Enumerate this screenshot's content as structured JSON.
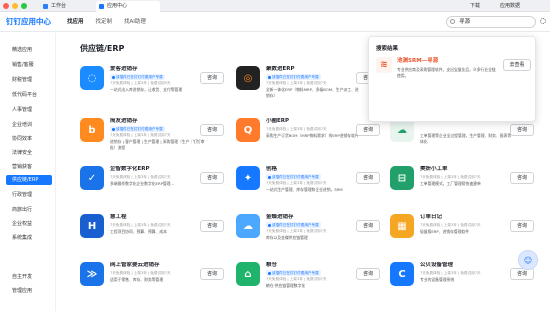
{
  "browser": {
    "tabs": [
      {
        "label": "工作台",
        "color": "#2b7ffc"
      },
      {
        "label": "应用中心",
        "color": "#1677ff"
      }
    ],
    "right_items": [
      "下载",
      "应用数据"
    ]
  },
  "header": {
    "brand": "钉钉应用中心",
    "nav": [
      "找应用",
      "找定制",
      "找AI助理"
    ],
    "search_value": "寻源"
  },
  "sidebar": {
    "items": [
      "精选应用",
      "销售/客服",
      "财税管理",
      "低代码平台",
      "人事管理",
      "企业培训",
      "协同效率",
      "法律安全",
      "营销获客",
      "供应链/ERP",
      "行政管理",
      "商旅出行",
      "企业权益",
      "系统集成",
      "自主开发",
      "管理应用"
    ],
    "active_index": 9
  },
  "main": {
    "section_title": "供应链/ERP",
    "consult_label": "咨询",
    "cards": [
      {
        "name": "爱客进销存",
        "badge": "该插件已在钉钉付费用户专属",
        "meta": "7天免费体验 | 上架3年 | 免费试用5天",
        "desc": "一站式出入库进销存，让收货、支付等管理",
        "logo_color": "#1a8cff",
        "logo_text": "◌"
      },
      {
        "name": "聚数进ERP",
        "badge": "该插件已在钉钉付费用户专属",
        "meta": "7天免费体验 | 上架3年 | 免费试用7天",
        "desc": "全新一体化ERP（物料MRP、多级BOM、生产派工、进销存）",
        "logo_color": "#222",
        "logo_text": "◎"
      },
      {
        "name": "",
        "badge": "",
        "meta": "",
        "desc": "",
        "logo_color": "#3d8bf5",
        "logo_text": "▤"
      },
      {
        "name": "简友进销存",
        "badge": "该插件已在钉钉付费用户专属",
        "meta": "7天免费体验 | 上架3年 | 免费试用7天",
        "desc": "进销存 | 客户管理 | 生产管理 | 采购管理（生产｜钉钉审批）流程",
        "logo_color": "#ff8a1f",
        "logo_text": "b"
      },
      {
        "name": "小圈ERP",
        "badge": "",
        "meta": "7天免费体验 | 上架3年 | 免费试用7天",
        "desc": "采购生产订货BOM（MRP物料需求）的ERP进销存软件",
        "logo_color": "#ff7a2a",
        "logo_text": "Q"
      },
      {
        "name": "",
        "badge": "",
        "meta": "",
        "desc": "工单管理等企业全过程管理，生产管理、财务、报表等一体化",
        "logo_color": "#e8f5ee",
        "logo_text": "☁"
      },
      {
        "name": "企智数字化ERP",
        "badge": "",
        "meta": "7天免费体验 | 上架3年 | 免费试用7天",
        "desc": "多端操作数字化企业数字化ERP管理...",
        "logo_color": "#1a73e8",
        "logo_text": "✓"
      },
      {
        "name": "创格",
        "badge": "该插件已在钉钉付费用户专属",
        "meta": "7天免费体验 | 上架3年 | 免费试用7天",
        "desc": "一站式生产管理、库存管理和企业进销，SRM",
        "logo_color": "#1677ff",
        "logo_text": "✦"
      },
      {
        "name": "美妍小工单",
        "badge": "",
        "meta": "7天免费体验 | 上架3年 | 免费试用7天",
        "desc": "工单管理模式，工厂管理帮快速建单",
        "logo_color": "#22a06b",
        "logo_text": "⊟"
      },
      {
        "name": "慧工程",
        "badge": "",
        "meta": "7天免费体验 | 上架3年 | 免费试用7天",
        "desc": "工程项目协同、预算、预算、成本",
        "logo_color": "#1a5fd0",
        "logo_text": "H"
      },
      {
        "name": "金蝶进销存",
        "badge": "该插件已在钉钉付费用户专属",
        "meta": "7天免费体验 | 上架3年 | 免费试用7天",
        "desc": "库存以及金蝶供应链管理",
        "logo_color": "#4ca7ff",
        "logo_text": "☁"
      },
      {
        "name": "订单日记",
        "badge": "",
        "meta": "7天免费体验 | 上架3年 | 免费试用7天",
        "desc": "轻量版ERP、进销存管理软件",
        "logo_color": "#f5a623",
        "logo_text": "▦"
      },
      {
        "name": "网上管家婆云进销存",
        "badge": "",
        "meta": "7天免费体验 | 上架3年 | 免费试用7天",
        "desc": "适用于零售、库存、财务等管理",
        "logo_color": "#1a73e8",
        "logo_text": "≫"
      },
      {
        "name": "粮仓",
        "badge": "该插件已在钉钉付费用户专属",
        "meta": "7天免费体验 | 上架3年 | 免费试用7天",
        "desc": "粮仓·供应链管理数字化",
        "logo_color": "#1fb36b",
        "logo_text": "⌂"
      },
      {
        "name": "公贝设备管理",
        "badge": "",
        "meta": "7天免费体验 | 上架3年 | 免费试用7天",
        "desc": "专业的设备管理系统",
        "logo_color": "#1677ff",
        "logo_text": "C"
      }
    ]
  },
  "popup": {
    "title": "搜索结果",
    "name": "池渊SRM—寻源",
    "desc": "专业供应商及采购管理软件，支出宝量业品，众多行业全链使用。",
    "button": "去查看"
  },
  "colors": {
    "accent": "#1677ff",
    "search_result": "#e8562e"
  }
}
